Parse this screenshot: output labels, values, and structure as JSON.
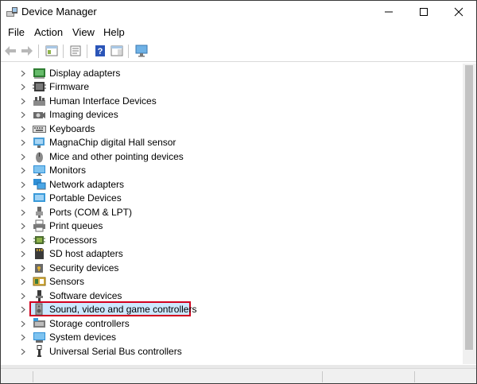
{
  "window": {
    "title": "Device Manager"
  },
  "menu": [
    "File",
    "Action",
    "View",
    "Help"
  ],
  "tree": [
    {
      "label": "Display adapters",
      "icon": "display-adapter-icon"
    },
    {
      "label": "Firmware",
      "icon": "firmware-icon"
    },
    {
      "label": "Human Interface Devices",
      "icon": "hid-icon"
    },
    {
      "label": "Imaging devices",
      "icon": "camera-icon"
    },
    {
      "label": "Keyboards",
      "icon": "keyboard-icon"
    },
    {
      "label": "MagnaChip digital Hall sensor",
      "icon": "sensor-icon"
    },
    {
      "label": "Mice and other pointing devices",
      "icon": "mouse-icon"
    },
    {
      "label": "Monitors",
      "icon": "monitor-icon"
    },
    {
      "label": "Network adapters",
      "icon": "network-adapter-icon"
    },
    {
      "label": "Portable Devices",
      "icon": "portable-device-icon"
    },
    {
      "label": "Ports (COM & LPT)",
      "icon": "port-icon"
    },
    {
      "label": "Print queues",
      "icon": "printer-icon"
    },
    {
      "label": "Processors",
      "icon": "processor-icon"
    },
    {
      "label": "SD host adapters",
      "icon": "sd-card-icon"
    },
    {
      "label": "Security devices",
      "icon": "security-device-icon"
    },
    {
      "label": "Sensors",
      "icon": "sensors-icon"
    },
    {
      "label": "Software devices",
      "icon": "software-device-icon"
    },
    {
      "label": "Sound, video and game controllers",
      "icon": "speaker-icon",
      "highlighted": true
    },
    {
      "label": "Storage controllers",
      "icon": "storage-controller-icon"
    },
    {
      "label": "System devices",
      "icon": "system-device-icon"
    },
    {
      "label": "Universal Serial Bus controllers",
      "icon": "usb-icon"
    }
  ]
}
